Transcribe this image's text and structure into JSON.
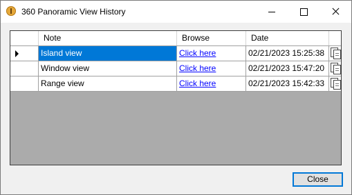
{
  "window": {
    "title": "360 Panoramic View History",
    "app_icon": "app-logo-icon",
    "controls": [
      "minimize-icon",
      "maximize-icon",
      "close-icon"
    ]
  },
  "grid": {
    "columns": [
      "",
      "Note",
      "Browse",
      "Date",
      ""
    ],
    "rows": [
      {
        "note": "Island view",
        "browse": "Click here",
        "date": "02/21/2023 15:25:38",
        "selected": true
      },
      {
        "note": "Window view",
        "browse": "Click here",
        "date": "02/21/2023 15:47:20",
        "selected": false
      },
      {
        "note": "Range view",
        "browse": "Click here",
        "date": "02/21/2023 15:42:33",
        "selected": false
      }
    ]
  },
  "footer": {
    "close_label": "Close"
  },
  "colors": {
    "selection": "#0078d7",
    "link": "#0000ff",
    "grid_background": "#ababab"
  }
}
